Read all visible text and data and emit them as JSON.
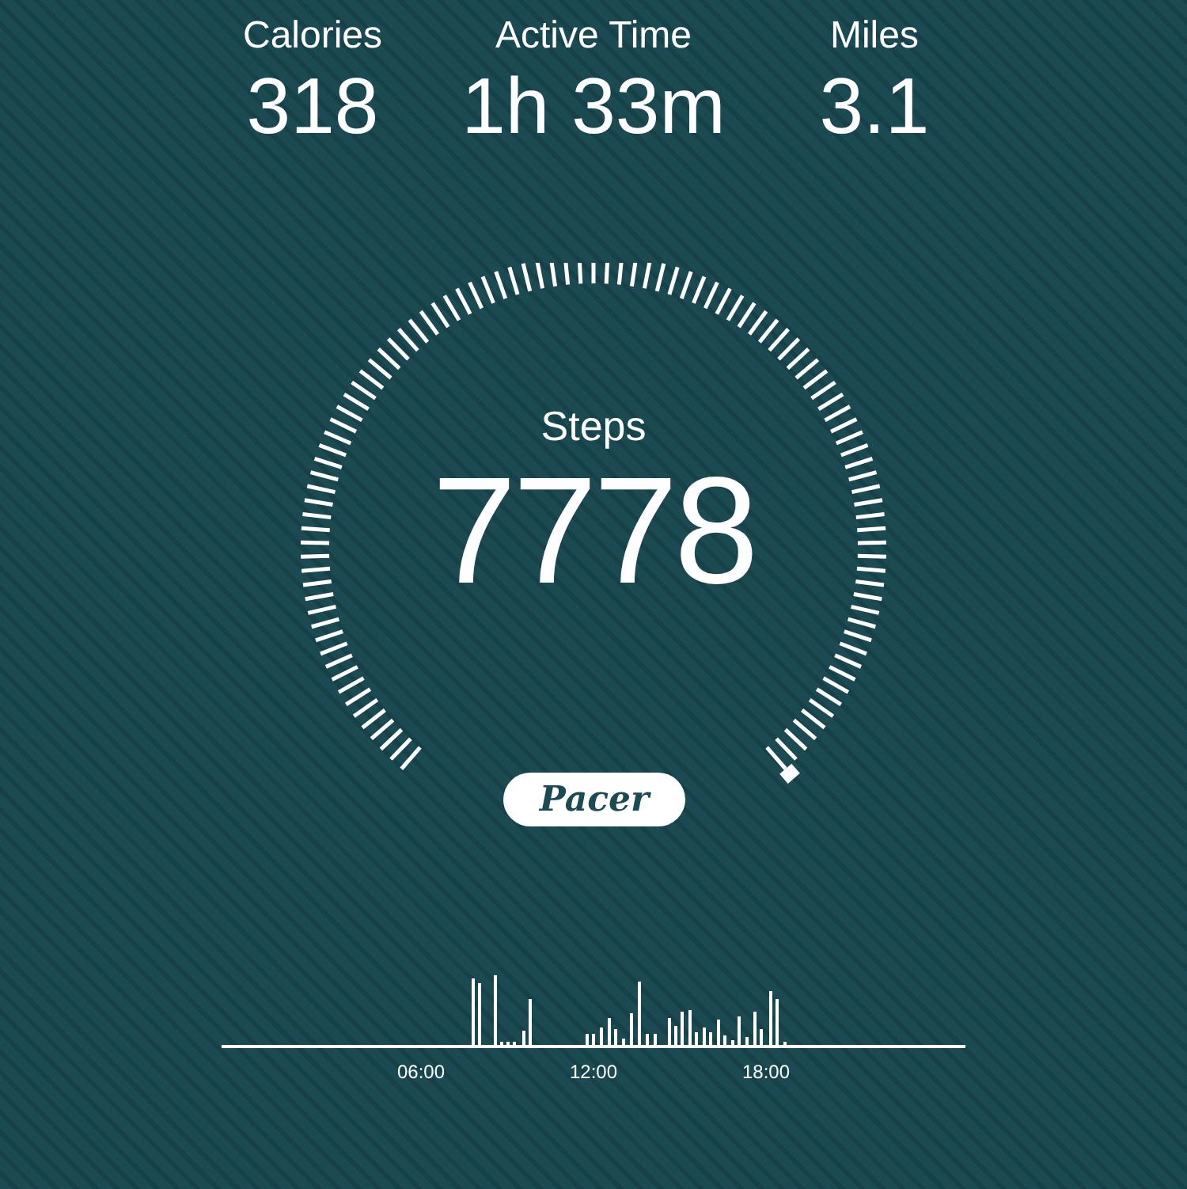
{
  "stats": [
    {
      "label": "Calories",
      "value": "318"
    },
    {
      "label": "Active Time",
      "value": "1h 33m"
    },
    {
      "label": "Miles",
      "value": "3.1"
    }
  ],
  "gauge": {
    "label": "Steps",
    "value": "7778"
  },
  "logo": "Pacer",
  "activity_chart": {
    "time_labels": [
      "06:00",
      "12:00",
      "18:00"
    ]
  }
}
